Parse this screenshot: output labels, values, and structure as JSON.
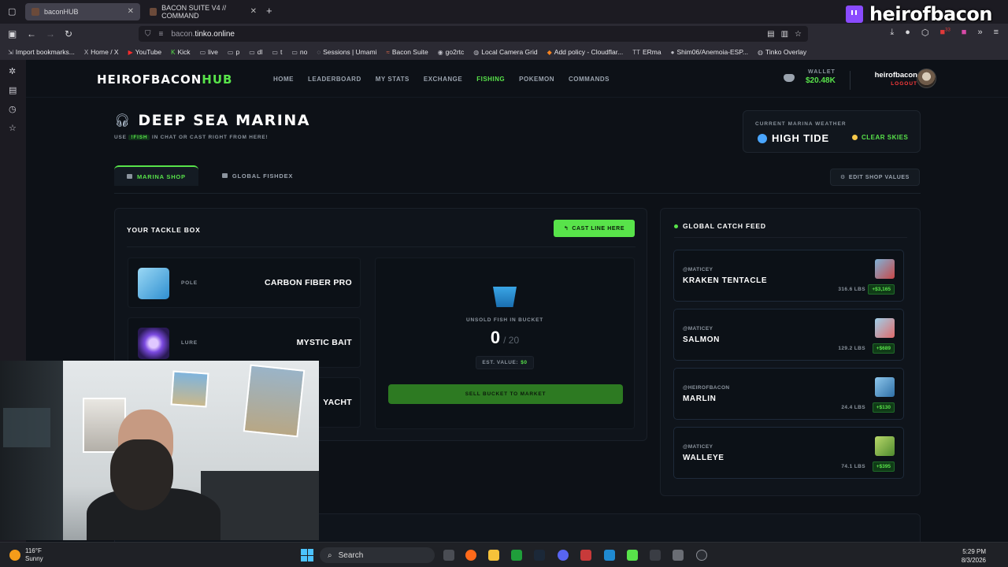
{
  "browser": {
    "tabs": [
      {
        "label": "baconHUB",
        "active": true
      },
      {
        "label": "BACON SUITE V4 // COMMAND",
        "active": false
      }
    ],
    "url_prefix": "bacon.",
    "url_domain": "tinko.online",
    "bookmarks": [
      "Import bookmarks...",
      "Home / X",
      "YouTube",
      "Kick",
      "live",
      "p",
      "dl",
      "t",
      "no",
      "Sessions | Umami",
      "Bacon Suite",
      "go2rtc",
      "Local Camera Grid",
      "Add policy - Cloudflar...",
      "ERma",
      "Shim06/Anemoia-ESP...",
      "Tinko Overlay"
    ],
    "notification_count": "33"
  },
  "twitch": {
    "channel": "heirofbacon"
  },
  "site": {
    "brand_main": "HEIROFBACON",
    "brand_accent": "HUB",
    "nav": [
      "HOME",
      "LEADERBOARD",
      "MY STATS",
      "EXCHANGE",
      "FISHING",
      "POKEMON",
      "COMMANDS"
    ],
    "active_nav": "FISHING",
    "wallet_label": "WALLET",
    "wallet_value": "$20.48K",
    "username": "heirofbacon",
    "logout": "LOGOUT"
  },
  "marina": {
    "title": "DEEP SEA MARINA",
    "subtitle_pre": "USE",
    "subtitle_cmd": "!FISH",
    "subtitle_post": "IN CHAT OR CAST RIGHT FROM HERE!",
    "weather_label": "CURRENT MARINA WEATHER",
    "tide": "HIGH TIDE",
    "sky": "CLEAR SKIES",
    "tabs": [
      "MARINA SHOP",
      "GLOBAL FISHDEX"
    ],
    "edit_button": "EDIT SHOP VALUES"
  },
  "tackle": {
    "header": "YOUR TACKLE BOX",
    "cast_button": "CAST LINE HERE",
    "items": [
      {
        "type": "POLE",
        "name": "CARBON FIBER PRO"
      },
      {
        "type": "LURE",
        "name": "MYSTIC BAIT"
      },
      {
        "type": "",
        "name": "YACHT"
      }
    ],
    "bucket_label": "UNSOLD FISH IN BUCKET",
    "bucket_count": "0",
    "bucket_max": "/ 20",
    "est_label": "EST. VALUE:",
    "est_value": "$0",
    "sell_button": "SELL BUCKET TO MARKET"
  },
  "feed": {
    "header": "GLOBAL CATCH FEED",
    "items": [
      {
        "user": "@MATICEY",
        "fish": "KRAKEN TENTACLE",
        "weight": "316.6 LBS",
        "price": "+$3,165"
      },
      {
        "user": "@MATICEY",
        "fish": "SALMON",
        "weight": "129.2 LBS",
        "price": "+$689"
      },
      {
        "user": "@HEIROFBACON",
        "fish": "MARLIN",
        "weight": "24.4 LBS",
        "price": "+$130"
      },
      {
        "user": "@MATICEY",
        "fish": "WALLEYE",
        "weight": "74.1 LBS",
        "price": "+$395"
      }
    ]
  },
  "taskbar": {
    "temp": "116°F",
    "condition": "Sunny",
    "search": "Search",
    "time": "5:29 PM",
    "date": "8/3/2026"
  },
  "colors": {
    "accent_green": "#58e34a",
    "logout_red": "#ff3b3b",
    "bg": "#0d1117"
  }
}
